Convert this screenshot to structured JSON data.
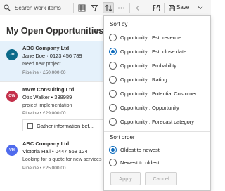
{
  "toolbar": {
    "search_placeholder": "Search work items",
    "save_label": "Save",
    "icons": [
      "search-icon",
      "grid-icon",
      "filter-icon",
      "sort-icon",
      "more-icon",
      "back-icon",
      "forward-icon",
      "popout-icon",
      "save-icon",
      "chevron-down-icon"
    ]
  },
  "list": {
    "view_title": "My Open Opportunities",
    "items": [
      {
        "initials": "JD",
        "avatar_color": "#0b6a8a",
        "account": "ABC Company Ltd",
        "contact": "Jane Doe · 0123 456 789",
        "description": "Need new project",
        "pipeline": "Pipeline • £50,000.00",
        "selected": true
      },
      {
        "initials": "OW",
        "avatar_color": "#c4314b",
        "account": "MVW Consulting Ltd",
        "contact": "Otis Walker • 338989",
        "description": "project implementation",
        "pipeline": "Pipeline • £29,000.00",
        "task": "Gather information bef...",
        "selected": false
      },
      {
        "initials": "VH",
        "avatar_color": "#4f6bed",
        "account": "ABC Company Ltd",
        "contact": "Victoria Hall • 0447 568 124",
        "description": "Looking for a quote for new services",
        "pipeline": "Pipeline • £25,000.00",
        "selected": false
      }
    ]
  },
  "sort_menu": {
    "sort_by_label": "Sort by",
    "options": [
      {
        "label": "Opportunity . Est. revenue",
        "selected": false
      },
      {
        "label": "Opportunity . Est. close date",
        "selected": true
      },
      {
        "label": "Opportunity . Probability",
        "selected": false
      },
      {
        "label": "Opportunity . Rating",
        "selected": false
      },
      {
        "label": "Opportunity . Potential Customer",
        "selected": false
      },
      {
        "label": "Opportunity . Opportunity",
        "selected": false
      },
      {
        "label": "Opportunity . Forecast category",
        "selected": false
      }
    ],
    "sort_order_label": "Sort order",
    "order_options": [
      {
        "label": "Oldest to newest",
        "selected": true
      },
      {
        "label": "Newest to oldest",
        "selected": false
      }
    ],
    "apply_label": "Apply",
    "cancel_label": "Cancel",
    "accent_color": "#0f6cbd"
  }
}
